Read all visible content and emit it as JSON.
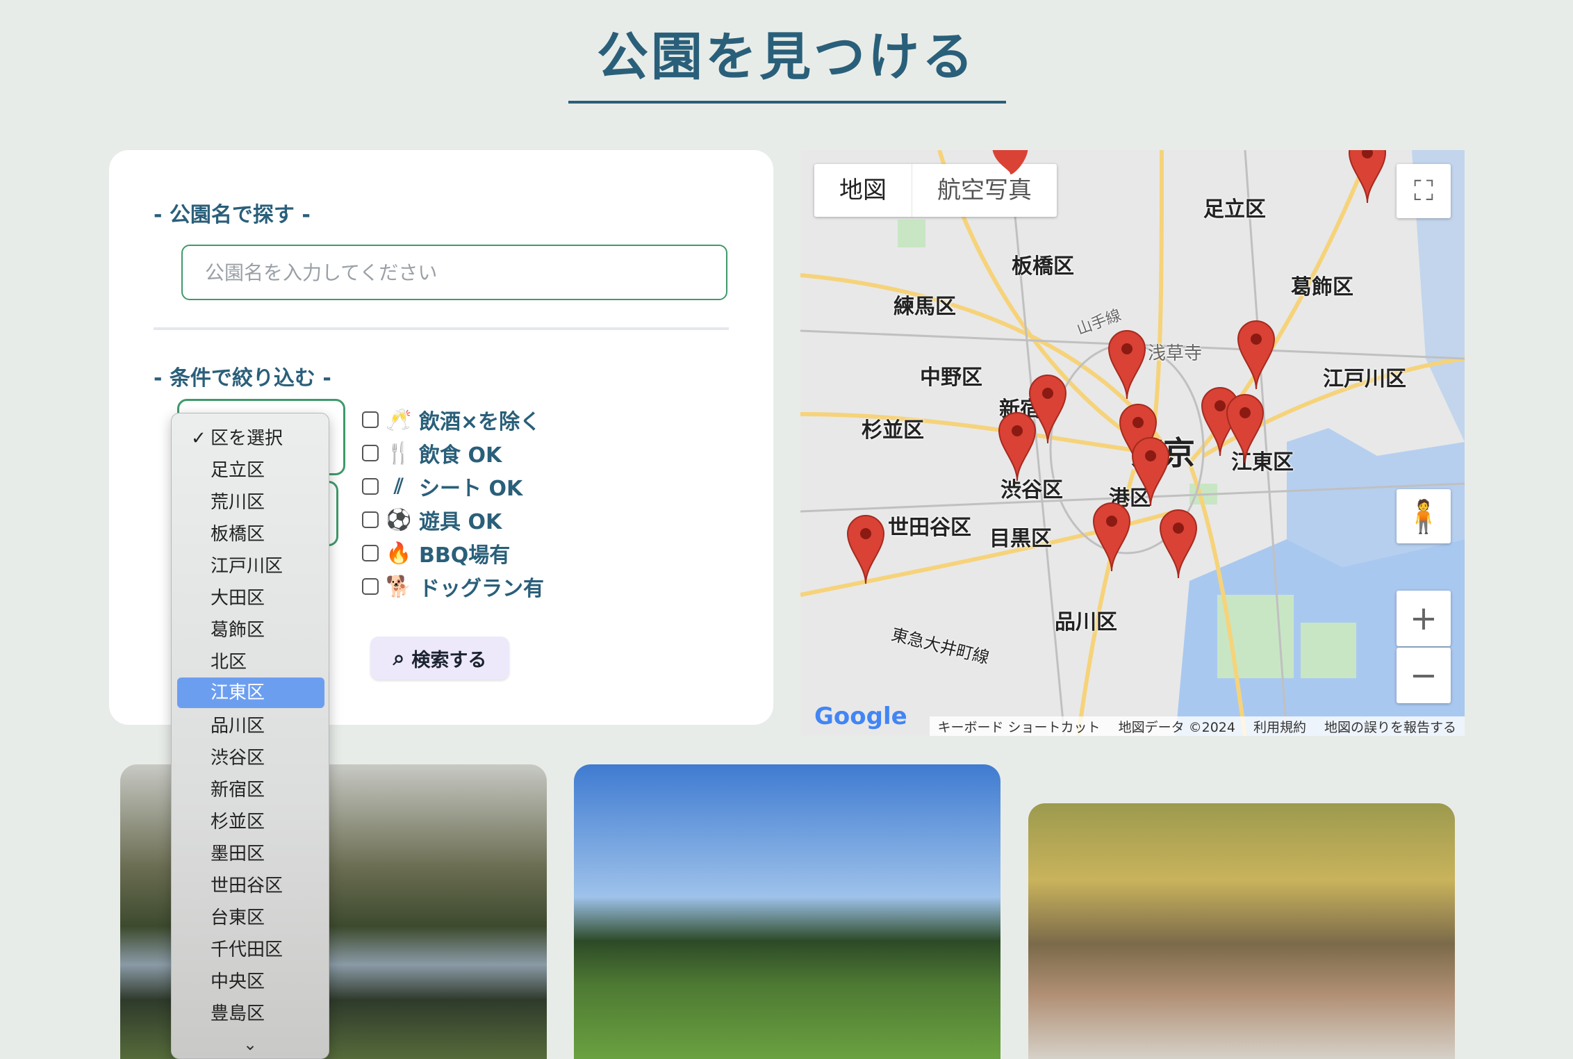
{
  "page": {
    "title": "公園を見つける"
  },
  "search": {
    "name_section_label": "- 公園名で探す -",
    "name_placeholder": "公園名を入力してください",
    "filter_section_label": "- 条件で絞り込む -",
    "checkboxes": [
      {
        "label": "飲酒×を除く",
        "icon": "cheers-icon"
      },
      {
        "label": "飲食 OK",
        "icon": "utensils-icon"
      },
      {
        "label": "シート OK",
        "icon": "sheet-icon"
      },
      {
        "label": "遊具 OK",
        "icon": "ball-icon"
      },
      {
        "label": "BBQ場有",
        "icon": "campfire-icon"
      },
      {
        "label": "ドッグラン有",
        "icon": "dog-icon"
      }
    ],
    "search_button": "検索する"
  },
  "ward_dropdown": {
    "checked": "区を選択",
    "highlighted": "江東区",
    "options": [
      "区を選択",
      "足立区",
      "荒川区",
      "板橋区",
      "江戸川区",
      "大田区",
      "葛飾区",
      "北区",
      "江東区",
      "品川区",
      "渋谷区",
      "新宿区",
      "杉並区",
      "墨田区",
      "世田谷区",
      "台東区",
      "千代田区",
      "中央区",
      "豊島区"
    ]
  },
  "map": {
    "tabs": [
      "地図",
      "航空写真"
    ],
    "labels": [
      "足立区",
      "板橋区",
      "葛飾区",
      "練馬区",
      "浅草寺",
      "中野区",
      "江戸川区",
      "新宿",
      "杉並区",
      "東京",
      "江東区",
      "渋谷区",
      "港区",
      "世田谷区",
      "目黒区",
      "品川区",
      "東急大井町線",
      "山手線"
    ],
    "footer": [
      "キーボード ショートカット",
      "地図データ ©2024",
      "利用規約",
      "地図の誤りを報告する"
    ],
    "logo": "Google",
    "colors": {
      "water": "#a9c8f0",
      "park": "#c8e6c4",
      "road": "#f6d37a",
      "pin": "#d94235"
    }
  }
}
